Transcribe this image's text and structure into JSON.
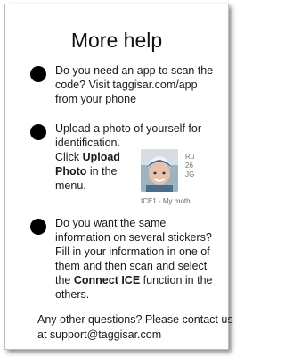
{
  "title": "More help",
  "items": [
    {
      "line1": "Do you need an app to scan the",
      "line2": "code? Visit taggisar.com/app",
      "line3": "from your phone"
    },
    {
      "line1": "Upload a photo of  yourself for",
      "line2": "identification.",
      "line3_prefix": "Click ",
      "bold1": "Upload",
      "bold2": "Photo",
      "line4_suffix": " in the",
      "line5": "menu."
    },
    {
      "line1": "Do you want the same",
      "line2": "information on several stickers?",
      "line3": "Fill in your information in one of",
      "line4": "them and then scan and select",
      "line5_prefix": "the ",
      "bold": "Connect ICE",
      "line5_suffix": " function in the",
      "line6": "others."
    }
  ],
  "thumbnail": {
    "meta1": "Ru",
    "meta2": "26",
    "meta3": "JG",
    "caption": "ICE1 - My moth"
  },
  "footer": {
    "line1": "Any other questions? Please contact us",
    "line2": "at support@taggisar.com"
  }
}
